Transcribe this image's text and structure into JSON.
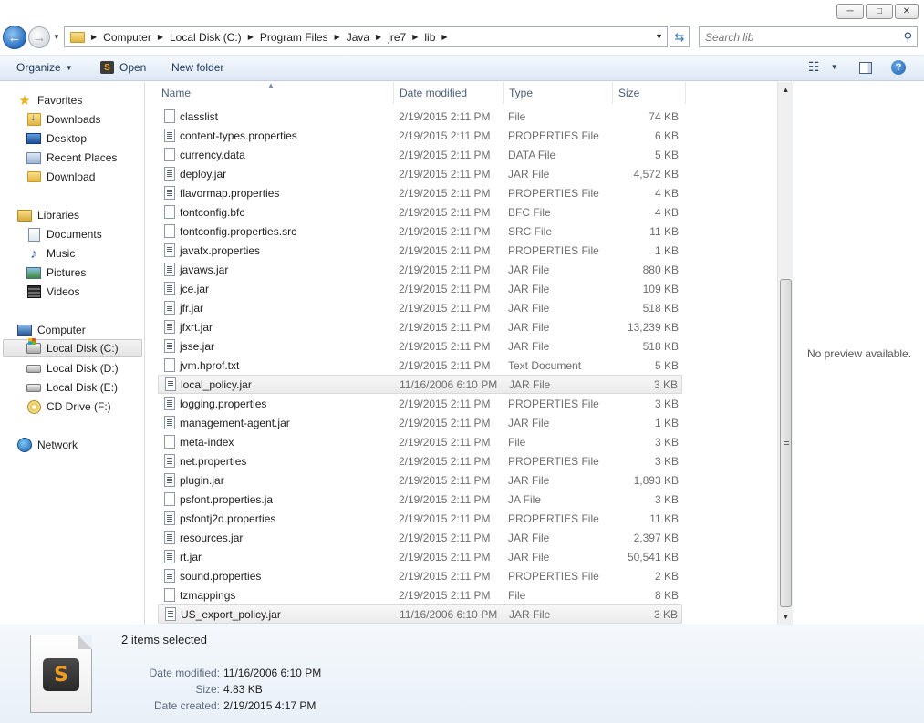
{
  "window": {
    "minimize_glyph": "─",
    "maximize_glyph": "□",
    "close_glyph": "✕"
  },
  "address": {
    "breadcrumbs": [
      "Computer",
      "Local Disk (C:)",
      "Program Files",
      "Java",
      "jre7",
      "lib"
    ]
  },
  "search": {
    "placeholder": "Search lib"
  },
  "toolbar": {
    "organize_label": "Organize",
    "open_label": "Open",
    "new_folder_label": "New folder"
  },
  "nav": {
    "favorites": "Favorites",
    "downloads": "Downloads",
    "desktop": "Desktop",
    "recent_places": "Recent Places",
    "download": "Download",
    "libraries": "Libraries",
    "documents": "Documents",
    "music": "Music",
    "pictures": "Pictures",
    "videos": "Videos",
    "computer": "Computer",
    "drive_c": "Local Disk (C:)",
    "drive_d": "Local Disk (D:)",
    "drive_e": "Local Disk (E:)",
    "drive_f": "CD Drive (F:)",
    "network": "Network"
  },
  "columns": {
    "name": "Name",
    "date": "Date modified",
    "type": "Type",
    "size": "Size"
  },
  "files": [
    {
      "name": "classlist",
      "date": "2/19/2015 2:11 PM",
      "type": "File",
      "size": "74 KB",
      "icon": "blank",
      "selected": false
    },
    {
      "name": "content-types.properties",
      "date": "2/19/2015 2:11 PM",
      "type": "PROPERTIES File",
      "size": "6 KB",
      "icon": "text",
      "selected": false
    },
    {
      "name": "currency.data",
      "date": "2/19/2015 2:11 PM",
      "type": "DATA File",
      "size": "5 KB",
      "icon": "blank",
      "selected": false
    },
    {
      "name": "deploy.jar",
      "date": "2/19/2015 2:11 PM",
      "type": "JAR File",
      "size": "4,572 KB",
      "icon": "text",
      "selected": false
    },
    {
      "name": "flavormap.properties",
      "date": "2/19/2015 2:11 PM",
      "type": "PROPERTIES File",
      "size": "4 KB",
      "icon": "text",
      "selected": false
    },
    {
      "name": "fontconfig.bfc",
      "date": "2/19/2015 2:11 PM",
      "type": "BFC File",
      "size": "4 KB",
      "icon": "blank",
      "selected": false
    },
    {
      "name": "fontconfig.properties.src",
      "date": "2/19/2015 2:11 PM",
      "type": "SRC File",
      "size": "11 KB",
      "icon": "blank",
      "selected": false
    },
    {
      "name": "javafx.properties",
      "date": "2/19/2015 2:11 PM",
      "type": "PROPERTIES File",
      "size": "1 KB",
      "icon": "text",
      "selected": false
    },
    {
      "name": "javaws.jar",
      "date": "2/19/2015 2:11 PM",
      "type": "JAR File",
      "size": "880 KB",
      "icon": "text",
      "selected": false
    },
    {
      "name": "jce.jar",
      "date": "2/19/2015 2:11 PM",
      "type": "JAR File",
      "size": "109 KB",
      "icon": "text",
      "selected": false
    },
    {
      "name": "jfr.jar",
      "date": "2/19/2015 2:11 PM",
      "type": "JAR File",
      "size": "518 KB",
      "icon": "text",
      "selected": false
    },
    {
      "name": "jfxrt.jar",
      "date": "2/19/2015 2:11 PM",
      "type": "JAR File",
      "size": "13,239 KB",
      "icon": "text",
      "selected": false
    },
    {
      "name": "jsse.jar",
      "date": "2/19/2015 2:11 PM",
      "type": "JAR File",
      "size": "518 KB",
      "icon": "text",
      "selected": false
    },
    {
      "name": "jvm.hprof.txt",
      "date": "2/19/2015 2:11 PM",
      "type": "Text Document",
      "size": "5 KB",
      "icon": "blank",
      "selected": false
    },
    {
      "name": "local_policy.jar",
      "date": "11/16/2006 6:10 PM",
      "type": "JAR File",
      "size": "3 KB",
      "icon": "text",
      "selected": true
    },
    {
      "name": "logging.properties",
      "date": "2/19/2015 2:11 PM",
      "type": "PROPERTIES File",
      "size": "3 KB",
      "icon": "text",
      "selected": false
    },
    {
      "name": "management-agent.jar",
      "date": "2/19/2015 2:11 PM",
      "type": "JAR File",
      "size": "1 KB",
      "icon": "text",
      "selected": false
    },
    {
      "name": "meta-index",
      "date": "2/19/2015 2:11 PM",
      "type": "File",
      "size": "3 KB",
      "icon": "blank",
      "selected": false
    },
    {
      "name": "net.properties",
      "date": "2/19/2015 2:11 PM",
      "type": "PROPERTIES File",
      "size": "3 KB",
      "icon": "text",
      "selected": false
    },
    {
      "name": "plugin.jar",
      "date": "2/19/2015 2:11 PM",
      "type": "JAR File",
      "size": "1,893 KB",
      "icon": "text",
      "selected": false
    },
    {
      "name": "psfont.properties.ja",
      "date": "2/19/2015 2:11 PM",
      "type": "JA File",
      "size": "3 KB",
      "icon": "blank",
      "selected": false
    },
    {
      "name": "psfontj2d.properties",
      "date": "2/19/2015 2:11 PM",
      "type": "PROPERTIES File",
      "size": "11 KB",
      "icon": "text",
      "selected": false
    },
    {
      "name": "resources.jar",
      "date": "2/19/2015 2:11 PM",
      "type": "JAR File",
      "size": "2,397 KB",
      "icon": "text",
      "selected": false
    },
    {
      "name": "rt.jar",
      "date": "2/19/2015 2:11 PM",
      "type": "JAR File",
      "size": "50,541 KB",
      "icon": "text",
      "selected": false
    },
    {
      "name": "sound.properties",
      "date": "2/19/2015 2:11 PM",
      "type": "PROPERTIES File",
      "size": "2 KB",
      "icon": "text",
      "selected": false
    },
    {
      "name": "tzmappings",
      "date": "2/19/2015 2:11 PM",
      "type": "File",
      "size": "8 KB",
      "icon": "blank",
      "selected": false
    },
    {
      "name": "US_export_policy.jar",
      "date": "11/16/2006 6:10 PM",
      "type": "JAR File",
      "size": "3 KB",
      "icon": "text",
      "selected": true
    }
  ],
  "preview": {
    "message": "No preview available."
  },
  "details": {
    "selection_text": "2 items selected",
    "thumb_glyph": "S",
    "date_modified_label": "Date modified:",
    "date_modified_value": "11/16/2006 6:10 PM",
    "size_label": "Size:",
    "size_value": "4.83 KB",
    "date_created_label": "Date created:",
    "date_created_value": "2/19/2015 4:17 PM"
  }
}
